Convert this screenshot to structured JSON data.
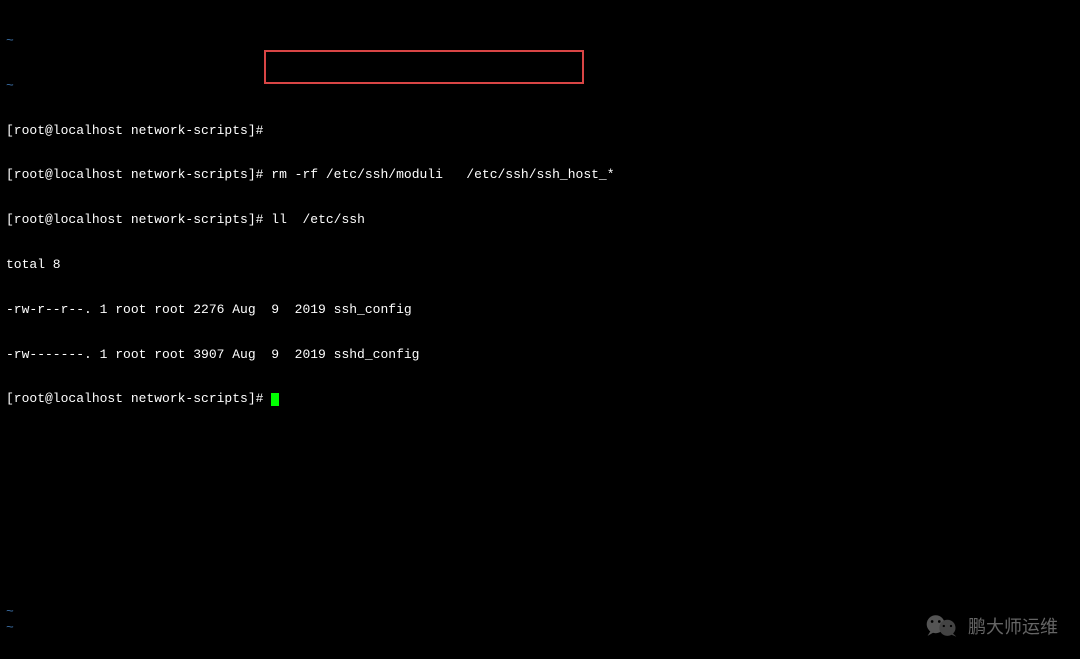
{
  "terminal": {
    "tilde1": "~",
    "tilde2": "~",
    "prompt": "[root@localhost network-scripts]#",
    "cmd1": "rm -rf /etc/ssh/moduli   /etc/ssh/ssh_host_*",
    "cmd2": "ll  /etc/ssh",
    "out_total": "total 8",
    "out_file1": "-rw-r--r--. 1 root root 2276 Aug  9  2019 ssh_config",
    "out_file2": "-rw-------. 1 root root 3907 Aug  9  2019 sshd_config",
    "bottom_tilde1": "~",
    "bottom_tilde2": "~"
  },
  "watermark": {
    "text": "鹏大师运维"
  }
}
